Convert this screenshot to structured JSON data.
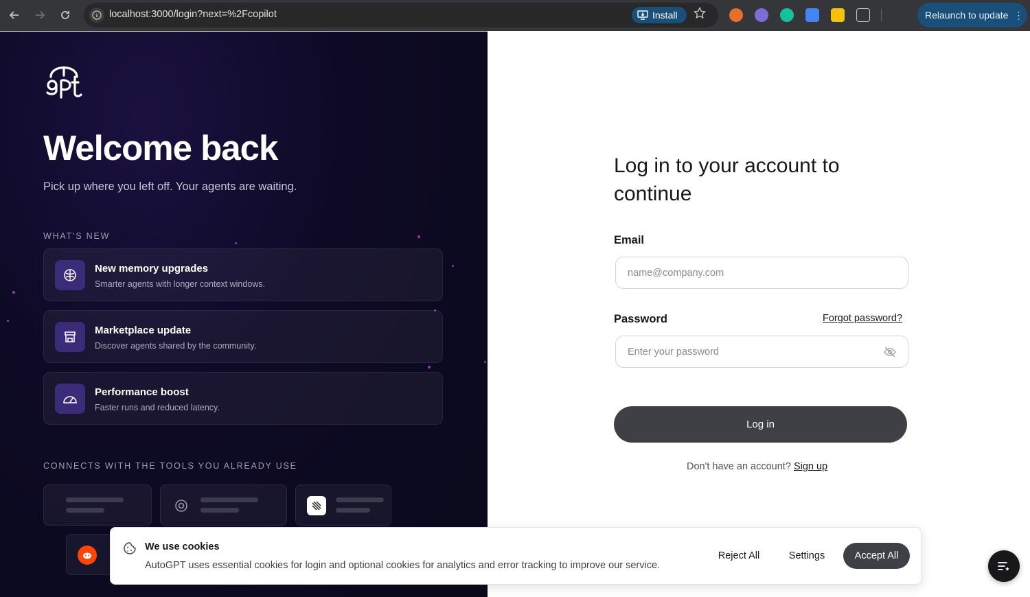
{
  "browser": {
    "url": "localhost:3000/login?next=%2Fcopilot",
    "install_label": "Install",
    "relaunch_label": "Relaunch to update"
  },
  "hero": {
    "logo_text": "gpt",
    "title": "Welcome back",
    "subtitle": "Pick up where you left off. Your agents are waiting.",
    "whats_new_heading": "WHAT'S NEW",
    "features": [
      {
        "title": "New memory upgrades",
        "description": "Smarter agents with longer context windows.",
        "icon": "brain-icon"
      },
      {
        "title": "Marketplace update",
        "description": "Discover agents shared by the community.",
        "icon": "store-icon"
      },
      {
        "title": "Performance boost",
        "description": "Faster runs and reduced latency.",
        "icon": "gauge-icon"
      }
    ],
    "connects_heading": "CONNECTS WITH THE TOOLS YOU ALREADY USE"
  },
  "login": {
    "title": "Log in to your account to continue",
    "email_label": "Email",
    "email_placeholder": "name@company.com",
    "email_value": "",
    "password_label": "Password",
    "forgot_label": "Forgot password?",
    "password_placeholder": "Enter your password",
    "password_value": "",
    "submit_label": "Log in",
    "signup_prompt": "Don't have an account?",
    "signup_label": "Sign up"
  },
  "cookies": {
    "title": "We use cookies",
    "text": "AutoGPT uses essential cookies for login and optional cookies for analytics and error tracking to improve our service.",
    "reject_label": "Reject All",
    "settings_label": "Settings",
    "accept_label": "Accept All"
  },
  "colors": {
    "hero_bg": "#0e0a26",
    "accent_purple": "#3b2c7a",
    "button_dark": "#3f3f46",
    "chrome_bg": "#35363a"
  }
}
